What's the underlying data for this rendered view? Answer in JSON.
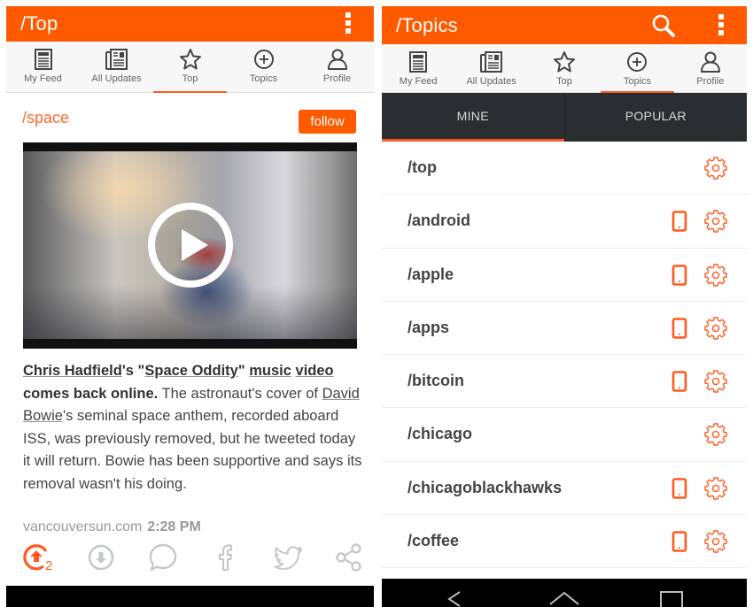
{
  "colors": {
    "brand": "#ff5a00",
    "accent": "#ff5a1f",
    "icon_gray": "#c5c8cc",
    "dark_tab_bg": "#2b2e31"
  },
  "left_screen": {
    "appbar": {
      "title": "/Top",
      "overflow_icon": "overflow-menu-icon"
    },
    "tabs": [
      {
        "label": "My Feed",
        "icon": "feed-icon",
        "active": false
      },
      {
        "label": "All Updates",
        "icon": "newspaper-icon",
        "active": false
      },
      {
        "label": "Top",
        "icon": "star-icon",
        "active": true
      },
      {
        "label": "Topics",
        "icon": "plus-circle-icon",
        "active": false
      },
      {
        "label": "Profile",
        "icon": "person-icon",
        "active": false
      }
    ],
    "post": {
      "topic": "/space",
      "follow_label": "follow",
      "video": {
        "play_icon": "play-icon"
      },
      "headline": {
        "link1": "Chris Hadfield",
        "t1": "'s \"",
        "link2": "Space Oddity",
        "t2": "\" ",
        "link3": "music",
        "t3": " ",
        "link4": "video",
        "t4": "comes back online."
      },
      "body": {
        "t1": " The astronaut's cover of ",
        "link": "David Bowie",
        "t2": "'s seminal space anthem, recorded aboard ISS, was previously removed, but he tweeted today it will return. Bowie has been supportive and says its removal wasn't his doing."
      },
      "source": "vancouversun.com",
      "time": "2:28 PM",
      "actions": [
        {
          "name": "upvote",
          "icon": "upvote-icon",
          "count": "2"
        },
        {
          "name": "downvote",
          "icon": "downvote-icon"
        },
        {
          "name": "comment",
          "icon": "comment-icon"
        },
        {
          "name": "facebook",
          "icon": "facebook-icon"
        },
        {
          "name": "twitter",
          "icon": "twitter-icon"
        },
        {
          "name": "share",
          "icon": "share-icon"
        }
      ]
    }
  },
  "right_screen": {
    "appbar": {
      "title": "/Topics",
      "search_icon": "search-icon",
      "overflow_icon": "overflow-menu-icon"
    },
    "tabs": [
      {
        "label": "My Feed",
        "icon": "feed-icon",
        "active": false
      },
      {
        "label": "All Updates",
        "icon": "newspaper-icon",
        "active": false
      },
      {
        "label": "Top",
        "icon": "star-icon",
        "active": false
      },
      {
        "label": "Topics",
        "icon": "plus-circle-icon",
        "active": true
      },
      {
        "label": "Profile",
        "icon": "person-icon",
        "active": false
      }
    ],
    "subtabs": [
      {
        "label": "MINE",
        "active": true
      },
      {
        "label": "POPULAR",
        "active": false
      }
    ],
    "topics": [
      {
        "name": "/top",
        "push_enabled": false
      },
      {
        "name": "/android",
        "push_enabled": true
      },
      {
        "name": "/apple",
        "push_enabled": true
      },
      {
        "name": "/apps",
        "push_enabled": true
      },
      {
        "name": "/bitcoin",
        "push_enabled": true
      },
      {
        "name": "/chicago",
        "push_enabled": false
      },
      {
        "name": "/chicagoblackhawks",
        "push_enabled": true
      },
      {
        "name": "/coffee",
        "push_enabled": true
      }
    ],
    "navbar": [
      "back-icon",
      "home-icon",
      "recents-icon"
    ]
  }
}
